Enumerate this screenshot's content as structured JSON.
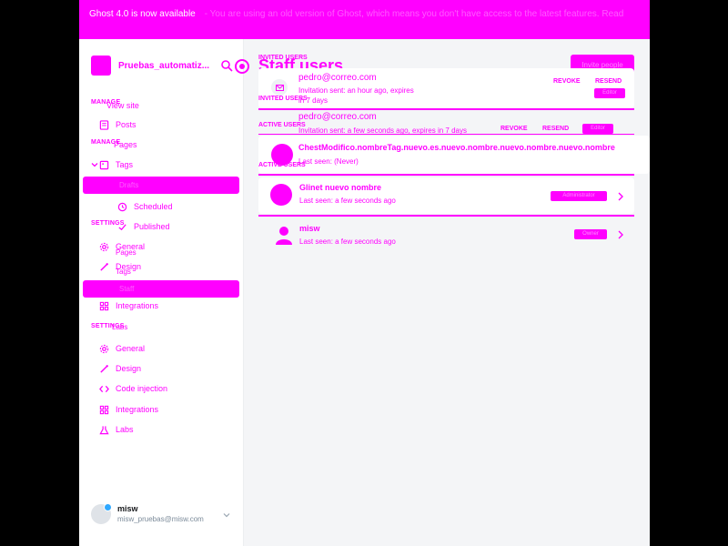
{
  "banner": {
    "text": "Ghost 4.0 is now available",
    "detail": "- You are using an old version of Ghost, which means you don't have access to the latest features. Read"
  },
  "sidebar": {
    "site_name": "Pruebas_automatiz...",
    "sections": {
      "manage": "MANAGE",
      "settings": "SETTINGS"
    },
    "items": [
      {
        "label": "View site",
        "icon": "home-icon"
      },
      {
        "label": "Posts",
        "icon": "posts-icon"
      },
      {
        "label": "Pages",
        "icon": "pages-icon"
      },
      {
        "label": "Tags",
        "icon": "tags-icon"
      },
      {
        "label": "Drafts",
        "icon": "drafts-icon"
      },
      {
        "label": "Scheduled",
        "icon": "clock-icon"
      },
      {
        "label": "Published",
        "icon": "check-icon"
      },
      {
        "label": "General",
        "icon": "gear-icon"
      },
      {
        "label": "Design",
        "icon": "brush-icon"
      },
      {
        "label": "Staff",
        "icon": "staff-icon"
      },
      {
        "label": "Integrations",
        "icon": "integrations-icon"
      },
      {
        "label": "Labs",
        "icon": "labs-icon"
      },
      {
        "label": "General",
        "icon": "gear-icon"
      },
      {
        "label": "Design",
        "icon": "brush-icon"
      },
      {
        "label": "Code injection",
        "icon": "code-icon"
      },
      {
        "label": "Integrations",
        "icon": "integrations-icon"
      },
      {
        "label": "Labs",
        "icon": "labs-icon"
      }
    ],
    "overlaps": {
      "tags_dup": "Tags",
      "pages_dup": "Pages",
      "labs_dup": "Labs"
    },
    "user": {
      "name": "misw",
      "email": "misw_pruebas@misw.com"
    }
  },
  "main": {
    "title": "Staff users",
    "invite_button": "Invite people",
    "labels": {
      "invited": "INVITED USERS",
      "active": "ACTIVE USERS"
    },
    "invited": [
      {
        "email": "pedro@correo.com",
        "meta": "Invitation sent: an hour ago, expires in 7 days",
        "revoke": "REVOKE",
        "resend": "RESEND",
        "role": "Editor"
      },
      {
        "email": "pedro@correo.com",
        "meta": "Invitation sent: a few seconds ago, expires in 7 days",
        "revoke": "REVOKE",
        "resend": "RESEND",
        "role": "Editor"
      }
    ],
    "active": [
      {
        "name": "ChestModifico.nombreTag.nuevo.es.nuevo.nombre.nuevo.nombre.nuevo.nombre",
        "seen": "Last seen: (Never)",
        "role": ""
      },
      {
        "name": "Glinet nuevo nombre",
        "seen": "Last seen: a few seconds ago",
        "role": "Administrator"
      },
      {
        "name": "misw",
        "seen": "Last seen: a few seconds ago",
        "role": "Owner"
      }
    ]
  },
  "colors": {
    "accent": "#ff00ff",
    "bg": "#f4f5f7"
  }
}
